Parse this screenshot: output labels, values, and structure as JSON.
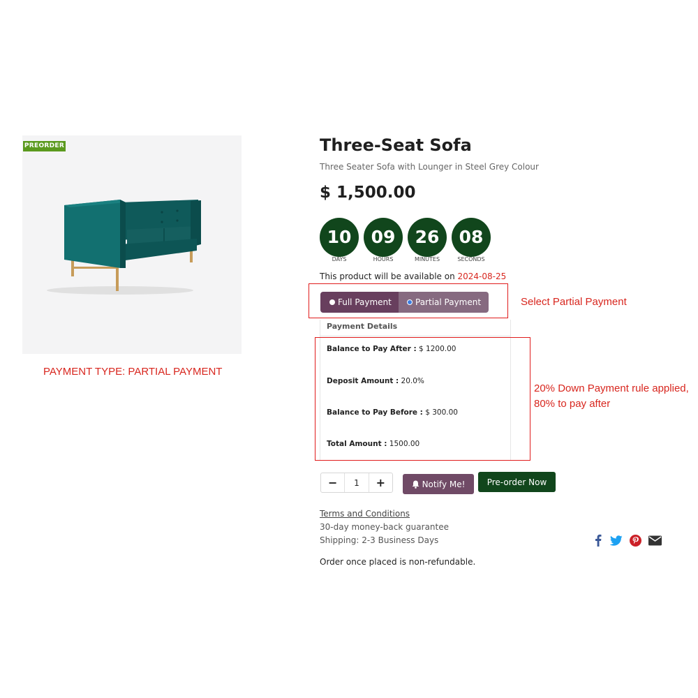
{
  "product": {
    "badge": "PREORDER",
    "title": "Three-Seat Sofa",
    "subtitle": "Three Seater Sofa with Lounger in Steel Grey Colour",
    "price": "$ 1,500.00"
  },
  "countdown": [
    {
      "value": "10",
      "label": "DAYS"
    },
    {
      "value": "09",
      "label": "HOURS"
    },
    {
      "value": "26",
      "label": "MINUTES"
    },
    {
      "value": "08",
      "label": "SECONDS"
    }
  ],
  "availability": {
    "text": "This product will be available on",
    "date": "2024-08-25"
  },
  "payment_toggle": {
    "full_label": "Full Payment",
    "partial_label": "Partial Payment",
    "selected": "Partial Payment"
  },
  "payment_details": {
    "heading": "Payment Details",
    "rows": [
      {
        "label": "Balance to Pay After :",
        "value": "$ 1200.00"
      },
      {
        "label": "Deposit Amount :",
        "value": "20.0%"
      },
      {
        "label": "Balance to Pay Before :",
        "value": "$ 300.00"
      },
      {
        "label": "Total Amount :",
        "value": "1500.00"
      }
    ]
  },
  "actions": {
    "qty_minus": "−",
    "qty_value": "1",
    "qty_plus": "+",
    "notify_label": "Notify Me!",
    "preorder_label": "Pre-order Now"
  },
  "info": {
    "terms": "Terms and Conditions",
    "guarantee": "30-day money-back guarantee",
    "shipping": "Shipping: 2-3 Business Days",
    "note": "Order once placed is non-refundable."
  },
  "annotations": {
    "payment_type": "PAYMENT TYPE: PARTIAL PAYMENT",
    "select_partial": "Select Partial Payment",
    "rule_line1": "20% Down Payment rule applied,",
    "rule_line2": "80% to pay after"
  },
  "social": {
    "icons": [
      "facebook-icon",
      "twitter-icon",
      "pinterest-icon",
      "email-icon"
    ],
    "colors": {
      "facebook": "#3b5998",
      "twitter": "#1da1f2",
      "pinterest": "#cb2027",
      "email": "#333333"
    }
  },
  "colors": {
    "countdown": "#11461c",
    "toggle_full": "#683f5e",
    "toggle_partial": "#866a80",
    "notify": "#704a66",
    "preorder": "#11461c",
    "annotation": "#d8261e",
    "badge": "#5b9a1e"
  }
}
